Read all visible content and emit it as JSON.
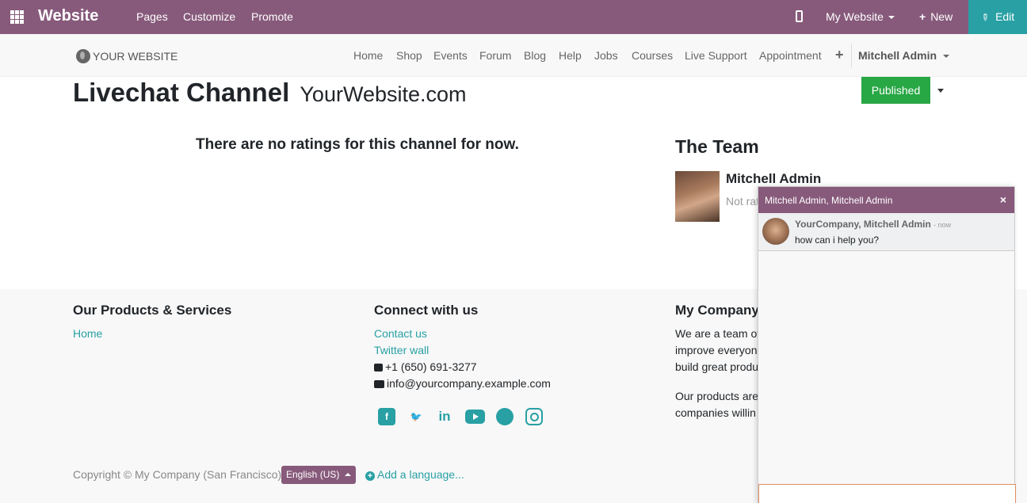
{
  "admin_bar": {
    "brand": "Website",
    "menus": [
      "Pages",
      "Customize",
      "Promote"
    ],
    "site_selector": "My Website",
    "new_label": "New",
    "edit_label": "Edit"
  },
  "header": {
    "logo": "YOUR WEBSITE",
    "nav": [
      "Home",
      "Shop",
      "Events",
      "Forum",
      "Blog",
      "Help",
      "Jobs",
      "Courses",
      "Live Support",
      "Appointment"
    ],
    "plus": "+",
    "user": "Mitchell Admin"
  },
  "main": {
    "title": "Livechat Channel",
    "subtitle": "YourWebsite.com",
    "published_label": "Published",
    "no_ratings": "There are no ratings for this channel for now.",
    "team_title": "The Team",
    "team_member_name": "Mitchell Admin",
    "team_member_status": "Not rated yet"
  },
  "footer": {
    "col1": {
      "heading": "Our Products & Services",
      "links": [
        "Home"
      ]
    },
    "col2": {
      "heading": "Connect with us",
      "links": [
        "Contact us",
        "Twitter wall"
      ],
      "phone": "+1 (650) 691-3277",
      "email": "info@yourcompany.example.com"
    },
    "col3": {
      "heading": "My Company",
      "para1_lines": [
        "We are a team of",
        "improve everyone",
        "build great produ"
      ],
      "para2_lines": [
        "Our products are",
        "companies willin"
      ]
    },
    "social_icons": [
      "facebook-icon",
      "twitter-icon",
      "linkedin-icon",
      "youtube-icon",
      "github-icon",
      "instagram-icon"
    ],
    "copyright": "Copyright © My Company (San Francisco)",
    "language": "English (US)",
    "add_language": "Add a language..."
  },
  "chat": {
    "title": "Mitchell Admin, Mitchell Admin",
    "close": "×",
    "author": "YourCompany, Mitchell Admin",
    "time": "now",
    "message": "how can i help you?",
    "input_value": ""
  },
  "colors": {
    "brand_purple": "#875a7b",
    "teal": "#28a0a4",
    "published_green": "#28a745"
  }
}
